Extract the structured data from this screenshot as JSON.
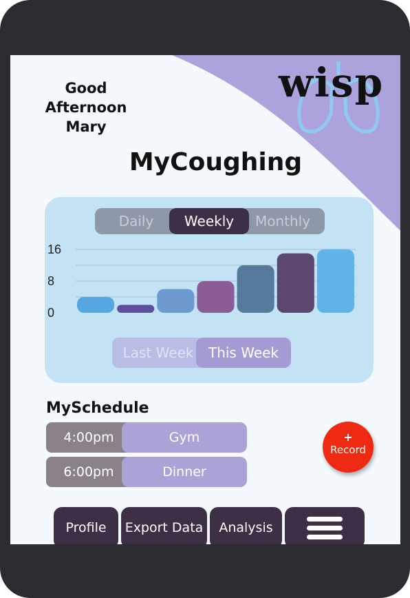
{
  "greeting": {
    "line1": "Good Afternoon",
    "line2": "Mary"
  },
  "logo": {
    "text": "wisp",
    "icon": "lungs-icon"
  },
  "page_title": "MyCoughing",
  "range_tabs": [
    "Daily",
    "Weekly",
    "Monthly"
  ],
  "range_selected": "Weekly",
  "week_tabs": [
    "Last Week",
    "This Week"
  ],
  "week_selected": "This Week",
  "chart_data": {
    "type": "bar",
    "categories": [
      "",
      "",
      "",
      "",
      "",
      "",
      ""
    ],
    "values": [
      4,
      2,
      6,
      8,
      12,
      15,
      16
    ],
    "colors": [
      "#55a7e0",
      "#5c4f9e",
      "#6e9bcf",
      "#8a5d99",
      "#567a9c",
      "#5b4770",
      "#5fb3e8"
    ],
    "yticks": [
      "16",
      "8",
      "0"
    ],
    "ylim": [
      0,
      16
    ],
    "grid": true
  },
  "schedule": {
    "title": "MySchedule",
    "items": [
      {
        "time": "4:00pm",
        "event": "Gym"
      },
      {
        "time": "6:00pm",
        "event": "Dinner"
      }
    ]
  },
  "record": {
    "plus": "+",
    "label": "Record"
  },
  "nav": {
    "profile": "Profile",
    "export": "Export Data",
    "analysis": "Analysis",
    "menu_icon": "hamburger-menu-icon"
  },
  "colors": {
    "accent_purple": "#aba3d8",
    "dark": "#3d2f45",
    "record_red": "#ee2a12",
    "card_blue": "#c3e3f5"
  }
}
